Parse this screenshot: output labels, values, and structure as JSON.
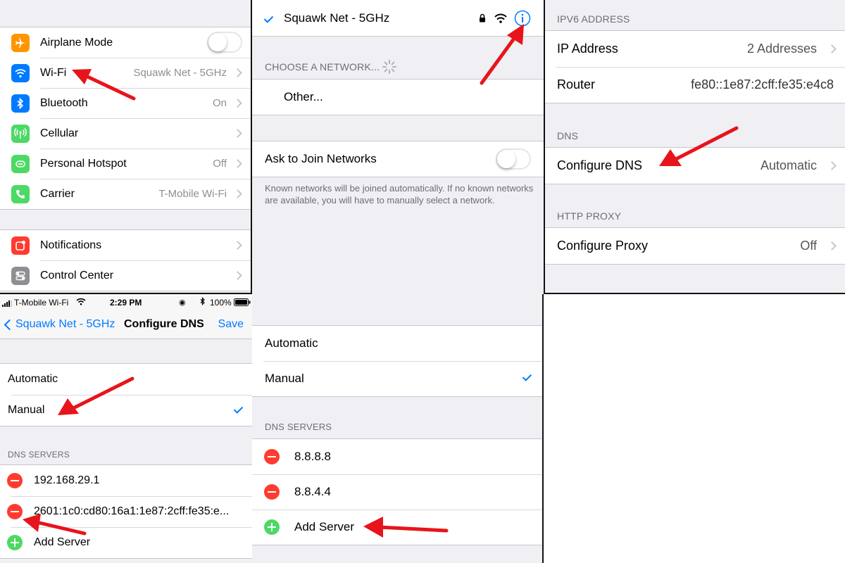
{
  "settings": {
    "items_group1": [
      {
        "label": "Airplane Mode",
        "icon": "airplane-icon",
        "color": "#ff9500"
      },
      {
        "label": "Wi-Fi",
        "value": "Squawk Net - 5GHz",
        "icon": "wifi-icon",
        "color": "#007aff"
      },
      {
        "label": "Bluetooth",
        "value": "On",
        "icon": "bluetooth-icon",
        "color": "#007aff"
      },
      {
        "label": "Cellular",
        "icon": "cellular-icon",
        "color": "#4cd964"
      },
      {
        "label": "Personal Hotspot",
        "value": "Off",
        "icon": "hotspot-icon",
        "color": "#4cd964"
      },
      {
        "label": "Carrier",
        "value": "T-Mobile Wi-Fi",
        "icon": "phone-icon",
        "color": "#4cd964"
      }
    ],
    "items_group2": [
      {
        "label": "Notifications",
        "icon": "notifications-icon",
        "color": "#ff3b30"
      },
      {
        "label": "Control Center",
        "icon": "control-center-icon",
        "color": "#8e8e93"
      }
    ]
  },
  "wifi": {
    "connected_network": "Squawk Net - 5GHz",
    "choose_header": "CHOOSE A NETWORK...",
    "other_label": "Other...",
    "ask_label": "Ask to Join Networks",
    "ask_footnote": "Known networks will be joined automatically. If no known networks are available, you will have to manually select a network."
  },
  "network_details": {
    "ipv6_header": "IPV6 ADDRESS",
    "ip_address_label": "IP Address",
    "ip_address_value": "2 Addresses",
    "router_label": "Router",
    "router_value": "fe80::1e87:2cff:fe35:e4c8",
    "dns_header": "DNS",
    "configure_dns_label": "Configure DNS",
    "configure_dns_value": "Automatic",
    "http_proxy_header": "HTTP PROXY",
    "configure_proxy_label": "Configure Proxy",
    "configure_proxy_value": "Off"
  },
  "status_bar": {
    "carrier": "T-Mobile Wi-Fi",
    "time": "2:29 PM",
    "battery": "100%"
  },
  "configure_dns": {
    "back_label": "Squawk Net - 5GHz",
    "title": "Configure DNS",
    "save_label": "Save",
    "automatic_label": "Automatic",
    "manual_label": "Manual",
    "servers_header": "DNS SERVERS",
    "servers": [
      "192.168.29.1",
      "2601:1c0:cd80:16a1:1e87:2cff:fe35:e..."
    ],
    "add_server_label": "Add Server"
  },
  "configure_dns_new": {
    "automatic_label": "Automatic",
    "manual_label": "Manual",
    "servers_header": "DNS SERVERS",
    "servers": [
      "8.8.8.8",
      "8.8.4.4"
    ],
    "add_server_label": "Add Server"
  },
  "colors": {
    "ios_blue": "#007aff",
    "annotation_red": "#e8141b",
    "destructive_red": "#ff3b30",
    "add_green": "#4cd964"
  }
}
